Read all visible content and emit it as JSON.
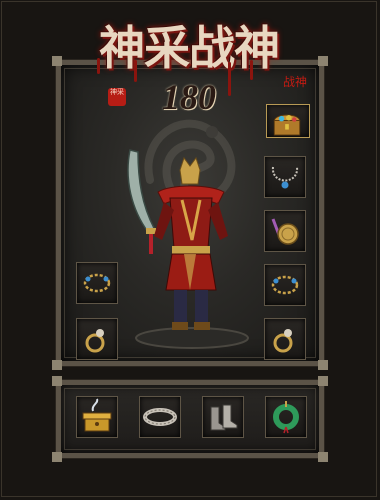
{
  "title": {
    "main": "神采战神",
    "level": "180",
    "seal_text": "神采",
    "stamp_text": "战神"
  },
  "colors": {
    "blood_red": "#8b140e",
    "frame_stone": "#5b5347",
    "gold": "#c9a24a"
  },
  "equipment": {
    "top_chest": {
      "icon": "treasure-chest-icon"
    },
    "right_slots": [
      {
        "icon": "necklace-icon"
      },
      {
        "icon": "medal-icon"
      },
      {
        "icon": "bracelet-icon"
      },
      {
        "icon": "ring-icon"
      }
    ],
    "left_slots": [
      {
        "icon": "bracelet-icon"
      },
      {
        "icon": "ring-icon"
      }
    ],
    "bottom_slots": [
      {
        "icon": "treasure-box-icon"
      },
      {
        "icon": "belt-icon"
      },
      {
        "icon": "boots-icon"
      },
      {
        "icon": "jade-pendant-icon"
      }
    ]
  },
  "character": {
    "icon": "warrior-character",
    "weapon": "curved-sword-icon"
  }
}
